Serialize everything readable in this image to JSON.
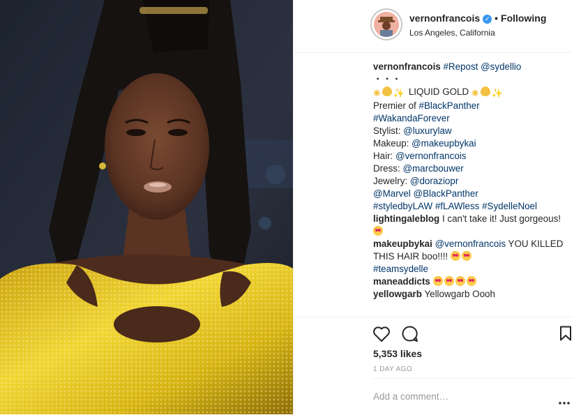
{
  "post": {
    "author": "vernonfrancois",
    "follow_separator": "•",
    "follow_status": "Following",
    "location": "Los Angeles, California"
  },
  "caption": {
    "author": "vernonfrancois",
    "repost_tag": "#Repost",
    "repost_user": "@sydellio",
    "dots": "・・・",
    "headline": "LIQUID GOLD",
    "premier_label": "Premier of",
    "premier_tag": "#BlackPanther",
    "tag_wakanda": "#WakandaForever",
    "stylist_label": "Stylist:",
    "stylist": "@luxurylaw",
    "makeup_label": "Makeup:",
    "makeup": "@makeupbykai",
    "hair_label": "Hair:",
    "hair": "@vernonfrancois",
    "dress_label": "Dress:",
    "dress": "@marcbouwer",
    "jewelry_label": "Jewelry:",
    "jewelry": "@doraziopr",
    "marvel": "@Marvel",
    "blackpanther": "@BlackPanther",
    "tag1": "#styledbyLAW",
    "tag2": "#fLAWless",
    "tag3": "#SydelleNoel"
  },
  "comments": [
    {
      "user": "lightingaleblog",
      "text": "I can't take it! Just gorgeous!"
    },
    {
      "user": "makeupbykai",
      "mention": "@vernonfrancois",
      "text": "YOU KILLED THIS HAIR boo!!!!",
      "tag": "#teamsydelle"
    },
    {
      "user": "maneaddicts",
      "text": ""
    },
    {
      "user": "yellowgarb",
      "text": "Yellowgarb Oooh"
    }
  ],
  "stats": {
    "likes": "5,353 likes",
    "time": "1 DAY AGO"
  },
  "add_comment": {
    "placeholder": "Add a comment…"
  },
  "icons": {
    "like": "heart-icon",
    "comment": "comment-icon",
    "save": "bookmark-icon",
    "more": "more-icon",
    "verified": "verified-badge-icon"
  },
  "colors": {
    "link": "#003569",
    "verified": "#3897f0",
    "muted": "#999999",
    "border": "#efefef",
    "dress_gold": "#e0c21a"
  }
}
